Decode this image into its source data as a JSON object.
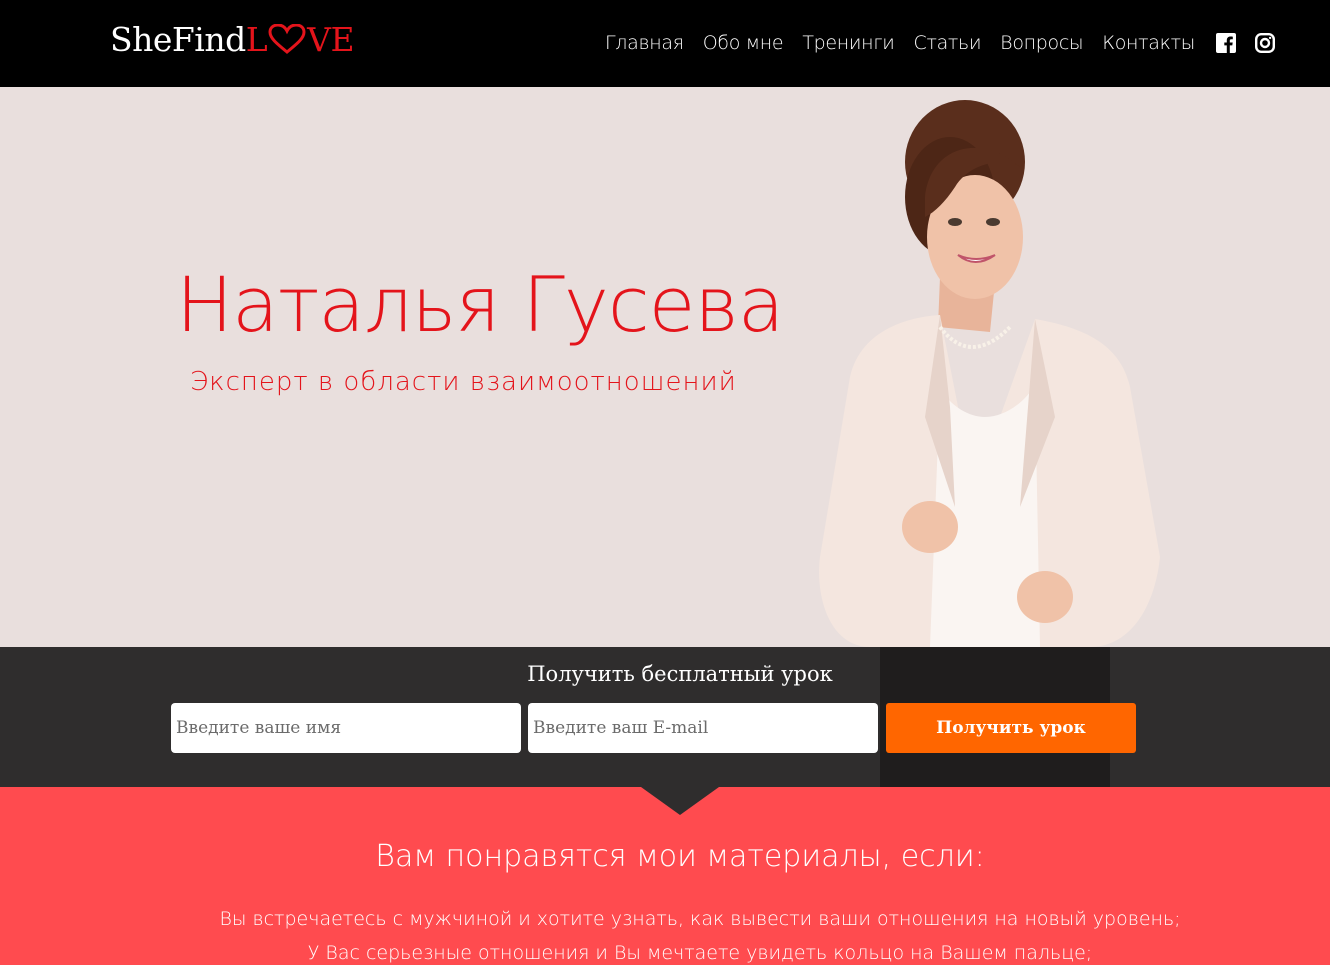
{
  "header": {
    "logo": {
      "part1": "SheFind",
      "part2_l": "L",
      "part2_rest": "VE"
    },
    "nav": [
      "Главная",
      "Обо мне",
      "Тренинги",
      "Статьи",
      "Вопросы",
      "Контакты"
    ],
    "social_icons": [
      "facebook-icon",
      "instagram-icon"
    ]
  },
  "hero": {
    "name": "Наталья Гусева",
    "subtitle": "Эксперт в области взаимоотношений"
  },
  "lead_form": {
    "title": "Получить бесплатный урок",
    "name_placeholder": "Введите ваше имя",
    "email_placeholder": "Введите ваш E-mail",
    "submit_label": "Получить урок"
  },
  "benefits": {
    "title": "Вам понравятся мои материалы, если:",
    "items": [
      "Вы встречаетесь с мужчиной и хотите узнать, как вывести ваши отношения на новый уровень;",
      "У Вас серьезные отношения и Вы мечтаете увидеть кольцо на Вашем пальце;"
    ]
  },
  "colors": {
    "header_bg": "#000000",
    "accent_red": "#e4141b",
    "hero_bg": "#e9dfdd",
    "form_bg": "#2f2d2d",
    "cta_orange": "#ff6600",
    "section_red": "#ff4b4f"
  }
}
